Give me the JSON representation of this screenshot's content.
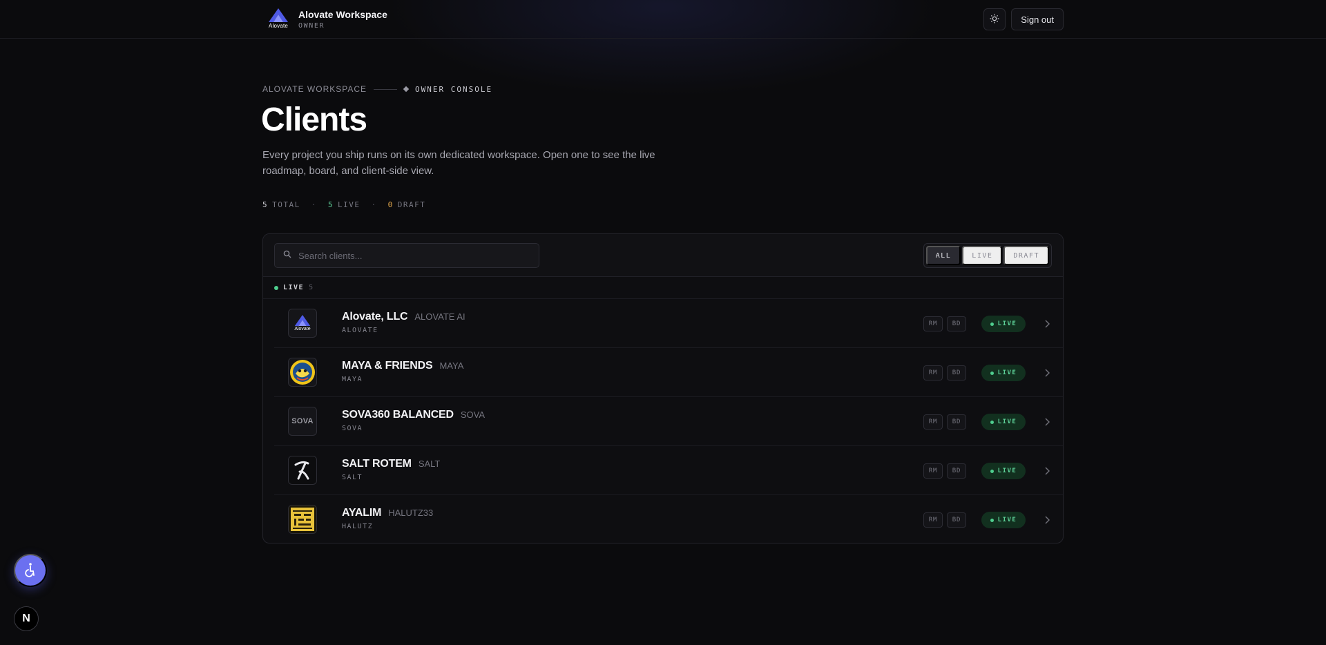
{
  "header": {
    "brand_wordmark": "Alovate",
    "workspace_name": "Alovate Workspace",
    "role": "OWNER",
    "signout_label": "Sign out",
    "theme_icon": "sun-icon"
  },
  "page": {
    "breadcrumb_root": "ALOVATE WORKSPACE",
    "breadcrumb_current": "OWNER CONSOLE",
    "title": "Clients",
    "description": "Every project you ship runs on its own dedicated workspace. Open one to see the live roadmap, board, and client-side view."
  },
  "stats": {
    "total_count": "5",
    "total_label": "TOTAL",
    "live_count": "5",
    "live_label": "LIVE",
    "draft_count": "0",
    "draft_label": "DRAFT",
    "separator": "·"
  },
  "toolbar": {
    "search_placeholder": "Search clients...",
    "filters": [
      "ALL",
      "LIVE",
      "DRAFT"
    ],
    "active_filter": "ALL"
  },
  "group": {
    "label": "LIVE",
    "count": "5"
  },
  "clients": [
    {
      "name": "Alovate, LLC",
      "alias": "ALOVATE AI",
      "slug": "ALOVATE",
      "tags": [
        "RM",
        "BD"
      ],
      "status": "LIVE",
      "logo": "alovate-logo",
      "logo_text": "Alovate"
    },
    {
      "name": "MAYA & FRIENDS",
      "alias": "MAYA",
      "slug": "MAYA",
      "tags": [
        "RM",
        "BD"
      ],
      "status": "LIVE",
      "logo": "maya-logo",
      "logo_text": ""
    },
    {
      "name": "SOVA360 BALANCED",
      "alias": "SOVA",
      "slug": "SOVA",
      "tags": [
        "RM",
        "BD"
      ],
      "status": "LIVE",
      "logo": "sova-logo",
      "logo_text": "SOVA"
    },
    {
      "name": "SALT ROTEM",
      "alias": "SALT",
      "slug": "SALT",
      "tags": [
        "RM",
        "BD"
      ],
      "status": "LIVE",
      "logo": "salt-logo",
      "logo_text": ""
    },
    {
      "name": "AYALIM",
      "alias": "HALUTZ33",
      "slug": "HALUTZ",
      "tags": [
        "RM",
        "BD"
      ],
      "status": "LIVE",
      "logo": "ayalim-logo",
      "logo_text": ""
    }
  ],
  "floating": {
    "accessibility_icon": "accessibility-icon",
    "next_badge": "N"
  },
  "colors": {
    "accent_live": "#5fd39a",
    "accent_draft": "#e0a64a",
    "fab": "#6b70f0",
    "background": "#0b0b0d"
  }
}
